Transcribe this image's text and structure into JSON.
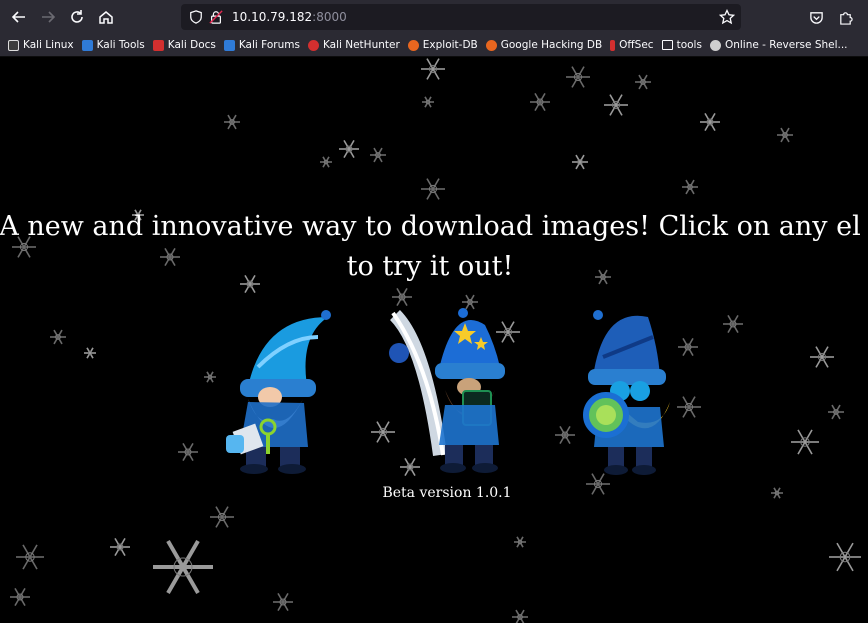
{
  "browser": {
    "url_host": "10.10.79.182",
    "url_port": ":8000",
    "bookmarks": [
      {
        "label": "Kali Linux",
        "color": "#ffffff"
      },
      {
        "label": "Kali Tools",
        "color": "#2f7bd8"
      },
      {
        "label": "Kali Docs",
        "color": "#d32f2f"
      },
      {
        "label": "Kali Forums",
        "color": "#2f7bd8"
      },
      {
        "label": "Kali NetHunter",
        "color": "#d32f2f"
      },
      {
        "label": "Exploit-DB",
        "color": "#e8661f"
      },
      {
        "label": "Google Hacking DB",
        "color": "#e8661f"
      },
      {
        "label": "OffSec",
        "color": "#d32f2f"
      },
      {
        "label": "tools",
        "color": "#fbfbfe"
      },
      {
        "label": "Online - Reverse Shel...",
        "color": "#cfcfcf"
      }
    ]
  },
  "page": {
    "headline_line1": "A new and innovative way to download images! Click on any el",
    "headline_line2": "to try it out!",
    "beta": "Beta version 1.0.1",
    "gnomes": [
      {
        "name": "gnome-key",
        "icon": "gnome-with-key-icon"
      },
      {
        "name": "gnome-quill",
        "icon": "gnome-wizard-with-quill-icon"
      },
      {
        "name": "gnome-magnifier",
        "icon": "gnome-with-magnifier-icon"
      }
    ]
  }
}
